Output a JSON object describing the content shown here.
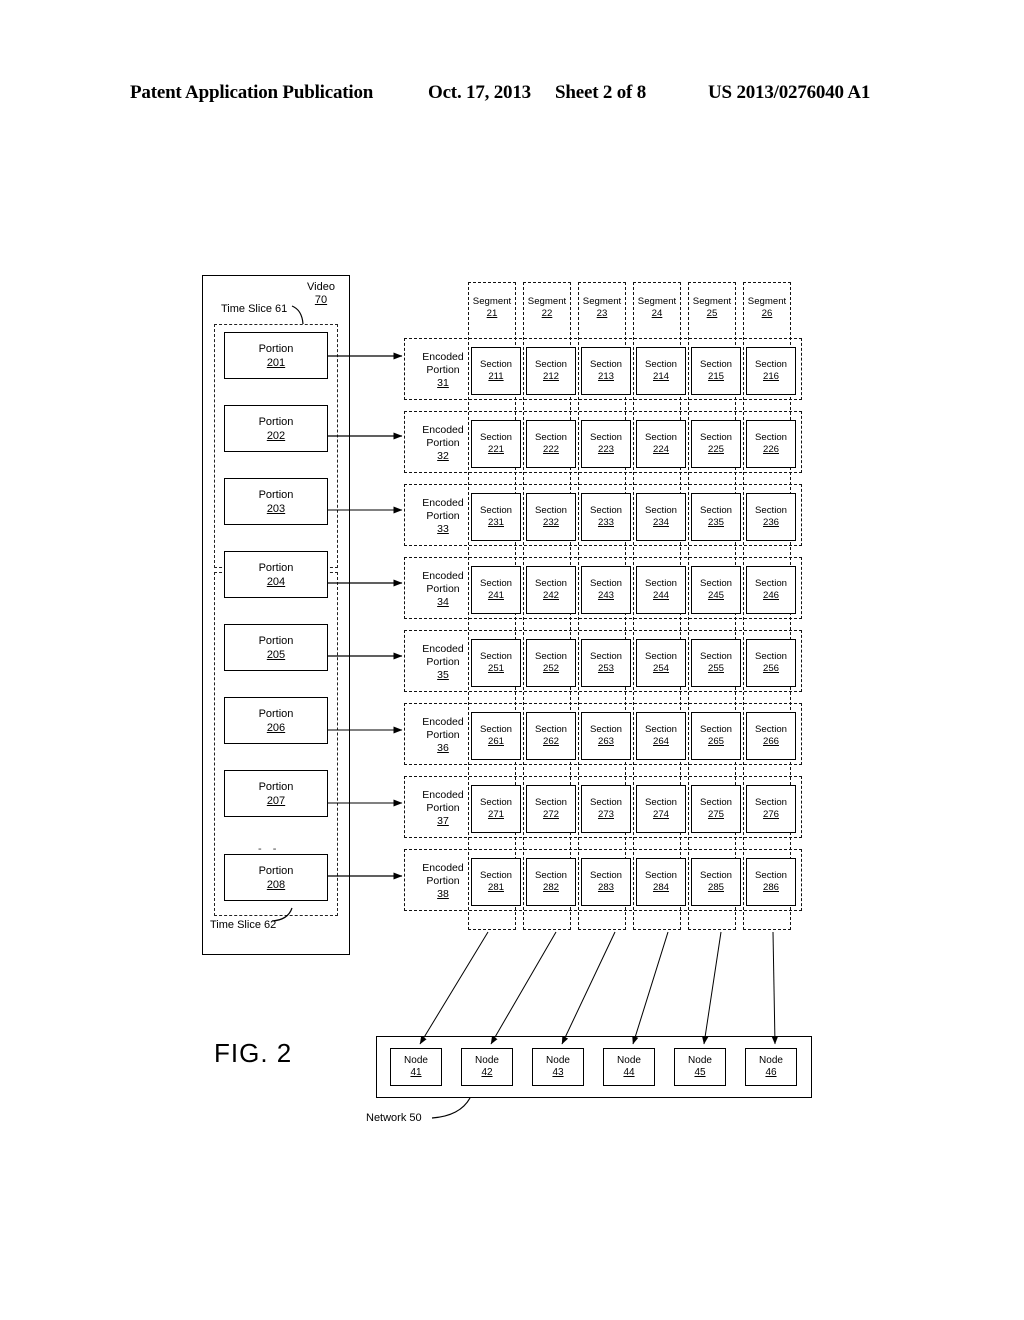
{
  "header": {
    "publication": "Patent Application Publication",
    "date": "Oct. 17, 2013",
    "sheet": "Sheet 2 of 8",
    "number": "US 2013/0276040 A1"
  },
  "figure": {
    "label": "FIG. 2",
    "video": {
      "title": "Video",
      "ref": "70"
    },
    "time_slices": [
      {
        "label": "Time Slice 61"
      },
      {
        "label": "Time Slice 62"
      }
    ],
    "ellipsis": "- -",
    "portions": [
      {
        "title": "Portion",
        "ref": "201"
      },
      {
        "title": "Portion",
        "ref": "202"
      },
      {
        "title": "Portion",
        "ref": "203"
      },
      {
        "title": "Portion",
        "ref": "204"
      },
      {
        "title": "Portion",
        "ref": "205"
      },
      {
        "title": "Portion",
        "ref": "206"
      },
      {
        "title": "Portion",
        "ref": "207"
      },
      {
        "title": "Portion",
        "ref": "208"
      }
    ],
    "encoded_portions": [
      {
        "title": "Encoded Portion",
        "line1": "Encoded",
        "line2": "Portion",
        "ref": "31"
      },
      {
        "title": "Encoded Portion",
        "line1": "Encoded",
        "line2": "Portion",
        "ref": "32"
      },
      {
        "title": "Encoded Portion",
        "line1": "Encoded",
        "line2": "Portion",
        "ref": "33"
      },
      {
        "title": "Encoded Portion",
        "line1": "Encoded",
        "line2": "Portion",
        "ref": "34"
      },
      {
        "title": "Encoded Portion",
        "line1": "Encoded",
        "line2": "Portion",
        "ref": "35"
      },
      {
        "title": "Encoded Portion",
        "line1": "Encoded",
        "line2": "Portion",
        "ref": "36"
      },
      {
        "title": "Encoded Portion",
        "line1": "Encoded",
        "line2": "Portion",
        "ref": "37"
      },
      {
        "title": "Encoded Portion",
        "line1": "Encoded",
        "line2": "Portion",
        "ref": "38"
      }
    ],
    "segments": [
      {
        "title": "Segment",
        "ref": "21"
      },
      {
        "title": "Segment",
        "ref": "22"
      },
      {
        "title": "Segment",
        "ref": "23"
      },
      {
        "title": "Segment",
        "ref": "24"
      },
      {
        "title": "Segment",
        "ref": "25"
      },
      {
        "title": "Segment",
        "ref": "26"
      }
    ],
    "section_rows": [
      {
        "title": "Section",
        "refs": [
          "211",
          "212",
          "213",
          "214",
          "215",
          "216"
        ]
      },
      {
        "title": "Section",
        "refs": [
          "221",
          "222",
          "223",
          "224",
          "225",
          "226"
        ]
      },
      {
        "title": "Section",
        "refs": [
          "231",
          "232",
          "233",
          "234",
          "235",
          "236"
        ]
      },
      {
        "title": "Section",
        "refs": [
          "241",
          "242",
          "243",
          "244",
          "245",
          "246"
        ]
      },
      {
        "title": "Section",
        "refs": [
          "251",
          "252",
          "253",
          "254",
          "255",
          "256"
        ]
      },
      {
        "title": "Section",
        "refs": [
          "261",
          "262",
          "263",
          "264",
          "265",
          "266"
        ]
      },
      {
        "title": "Section",
        "refs": [
          "271",
          "272",
          "273",
          "274",
          "275",
          "276"
        ]
      },
      {
        "title": "Section",
        "refs": [
          "281",
          "282",
          "283",
          "284",
          "285",
          "286"
        ]
      }
    ],
    "network": {
      "label": "Network 50"
    },
    "nodes": [
      {
        "title": "Node",
        "ref": "41"
      },
      {
        "title": "Node",
        "ref": "42"
      },
      {
        "title": "Node",
        "ref": "43"
      },
      {
        "title": "Node",
        "ref": "44"
      },
      {
        "title": "Node",
        "ref": "45"
      },
      {
        "title": "Node",
        "ref": "46"
      }
    ]
  }
}
